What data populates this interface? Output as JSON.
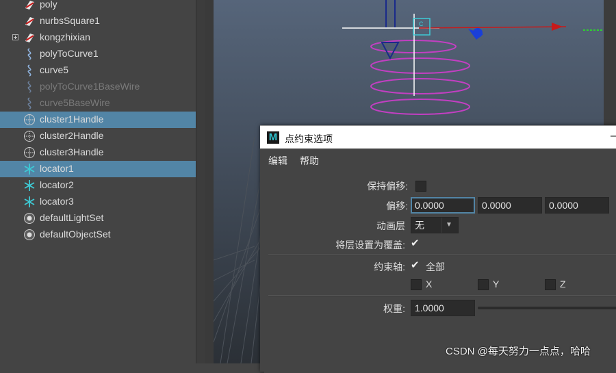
{
  "outliner": {
    "items": [
      {
        "label": "poly",
        "icon": "poly-icon",
        "selected": false,
        "dim": false,
        "expand": false
      },
      {
        "label": "nurbsSquare1",
        "icon": "nurbs-curve-icon",
        "selected": false,
        "dim": false,
        "expand": false
      },
      {
        "label": "kongzhixian",
        "icon": "nurbs-curve-icon",
        "selected": false,
        "dim": false,
        "expand": true
      },
      {
        "label": "polyToCurve1",
        "icon": "curve-icon",
        "selected": false,
        "dim": false,
        "expand": false
      },
      {
        "label": "curve5",
        "icon": "curve-icon",
        "selected": false,
        "dim": false,
        "expand": false
      },
      {
        "label": "polyToCurve1BaseWire",
        "icon": "curve-icon",
        "selected": false,
        "dim": true,
        "expand": false
      },
      {
        "label": "curve5BaseWire",
        "icon": "curve-icon",
        "selected": false,
        "dim": true,
        "expand": false
      },
      {
        "label": "cluster1Handle",
        "icon": "cluster-icon",
        "selected": true,
        "dim": false,
        "expand": false
      },
      {
        "label": "cluster2Handle",
        "icon": "cluster-icon",
        "selected": false,
        "dim": false,
        "expand": false
      },
      {
        "label": "cluster3Handle",
        "icon": "cluster-icon",
        "selected": false,
        "dim": false,
        "expand": false
      },
      {
        "label": "locator1",
        "icon": "locator-icon",
        "selected": true,
        "dim": false,
        "expand": false
      },
      {
        "label": "locator2",
        "icon": "locator-icon",
        "selected": false,
        "dim": false,
        "expand": false
      },
      {
        "label": "locator3",
        "icon": "locator-icon",
        "selected": false,
        "dim": false,
        "expand": false
      },
      {
        "label": "defaultLightSet",
        "icon": "set-icon",
        "selected": false,
        "dim": false,
        "expand": false
      },
      {
        "label": "defaultObjectSet",
        "icon": "set-icon",
        "selected": false,
        "dim": false,
        "expand": false
      }
    ]
  },
  "dialog": {
    "title": "点约束选项",
    "app_icon_letter": "M",
    "minimize": "–",
    "menus": [
      "编辑",
      "帮助"
    ],
    "maintain_offset_label": "保持偏移:",
    "offset_label": "偏移:",
    "offset_values": [
      "0.0000",
      "0.0000",
      "0.0000"
    ],
    "anim_layer_label": "动画层",
    "anim_layer_value": "无",
    "set_layer_override_label": "将层设置为覆盖:",
    "constraint_axes_label": "约束轴:",
    "all_label": "全部",
    "axes": [
      "X",
      "Y",
      "Z"
    ],
    "weight_label": "权重:",
    "weight_value": "1.0000"
  },
  "watermark": "CSDN @每天努力一点点，哈哈",
  "colors": {
    "selection": "#5285a6",
    "helix": "#c23fc2",
    "manip_blue": "#1a3fd8",
    "manip_red": "#c81a1a",
    "manip_green": "#2fd02f",
    "locator_cyan": "#3ecbd6"
  }
}
